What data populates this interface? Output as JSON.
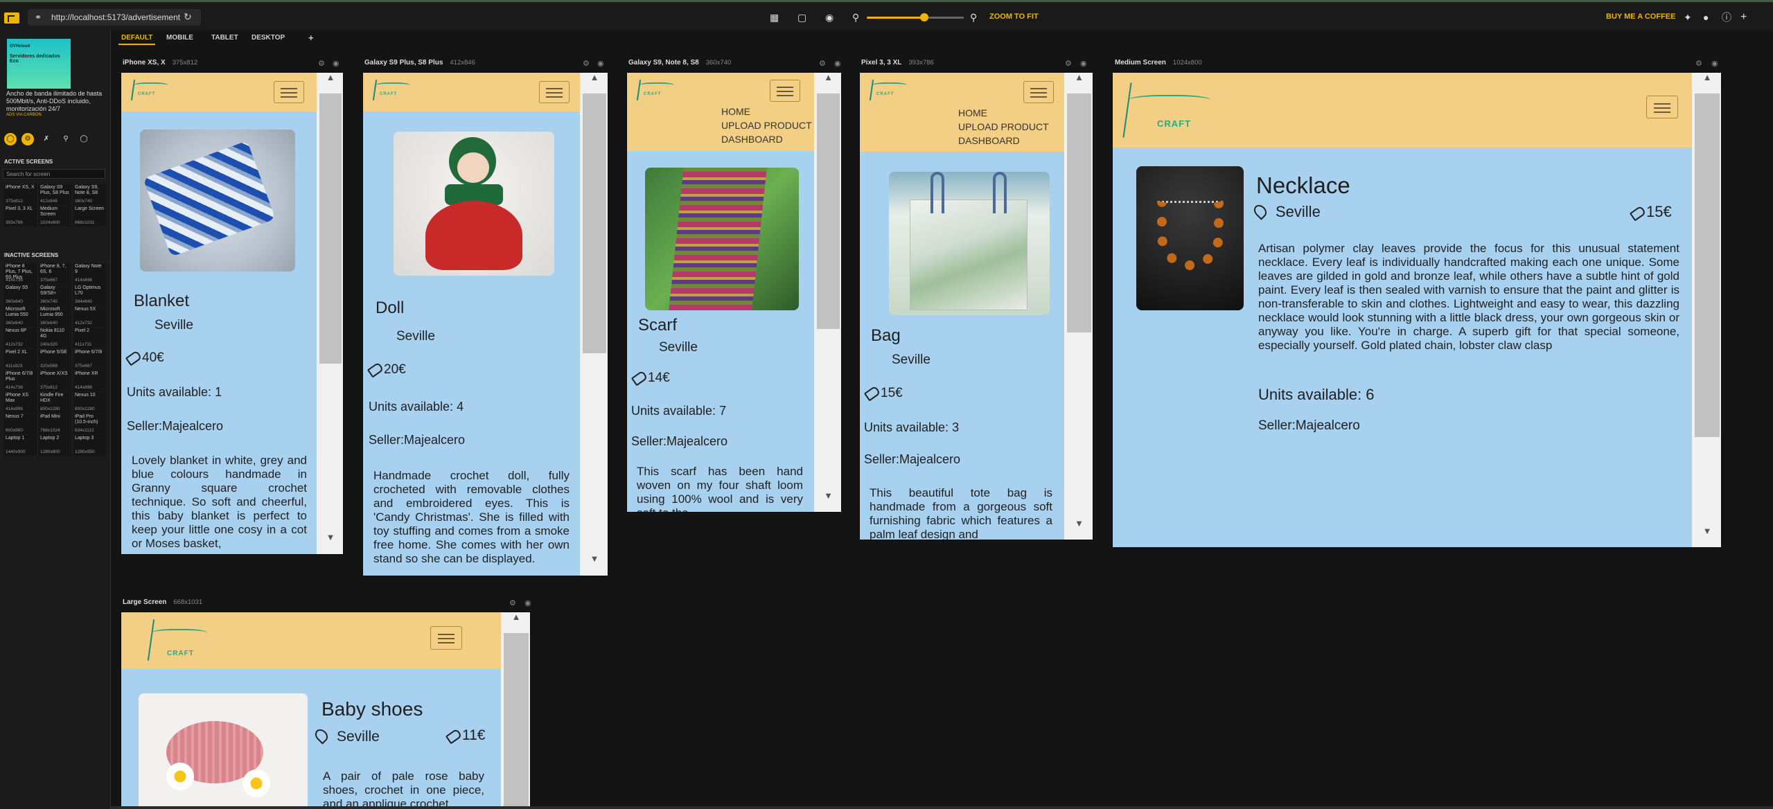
{
  "browser": {
    "url": "http://localhost:5173/advertisement",
    "zoom_to_fit": "ZOOM TO FIT",
    "buy_coffee": "BUY ME A COFFEE"
  },
  "tabs": [
    "DEFAULT",
    "MOBILE",
    "TABLET",
    "DESKTOP"
  ],
  "sidebar": {
    "ad": {
      "brand": "OVHcloud",
      "headline": "Servidores dedicados Eco",
      "text": "Ancho de banda ilimitado de hasta 500Mbit/s, Anti-DDoS incluido, monitorización 24/7",
      "link": "ADS VIA CARBON"
    },
    "active_title": "ACTIVE SCREENS",
    "search_placeholder": "Search for screen",
    "inactive_title": "INACTIVE SCREENS",
    "active": [
      [
        "iPhone XS, X",
        "375x812"
      ],
      [
        "Galaxy S9 Plus, S8 Plus",
        "412x846"
      ],
      [
        "Galaxy S9, Note 8, S8",
        "360x740"
      ],
      [
        "Pixel 3, 3 XL",
        "393x786"
      ],
      [
        "Medium Screen",
        "1024x800"
      ],
      [
        "Large Screen",
        "668x1031"
      ]
    ],
    "inactive": [
      [
        "iPhone 8 Plus, 7 Plus, 6S Plus",
        "414x736"
      ],
      [
        "iPhone 8, 7, 6S, 6",
        "375x667"
      ],
      [
        "Galaxy Note 9",
        "414x846"
      ],
      [
        "Galaxy S5",
        "360x640"
      ],
      [
        "Galaxy S9/S8+",
        "360x740"
      ],
      [
        "LG Optimus L70",
        "384x640"
      ],
      [
        "Microsoft Lumia 550",
        "360x640"
      ],
      [
        "Microsoft Lumia 950",
        "360x640"
      ],
      [
        "Nexus 5X",
        "412x732"
      ],
      [
        "Nexus 6P",
        "412x732"
      ],
      [
        "Nokia 8110 4G",
        "240x320"
      ],
      [
        "Pixel 2",
        "411x731"
      ],
      [
        "Pixel 2 XL",
        "411x823"
      ],
      [
        "iPhone 5/SE",
        "320x568"
      ],
      [
        "iPhone 6/7/8",
        "375x667"
      ],
      [
        "iPhone 6/7/8 Plus",
        "414x736"
      ],
      [
        "iPhone X/XS",
        "375x812"
      ],
      [
        "iPhone XR",
        "414x896"
      ],
      [
        "iPhone XS Max",
        "414x896"
      ],
      [
        "Kindle Fire HDX",
        "800x1280"
      ],
      [
        "Nexus 10",
        "800x1280"
      ],
      [
        "Nexus 7",
        "600x960"
      ],
      [
        "iPad Mini",
        "768x1024"
      ],
      [
        "iPad Pro (10.5-inch)",
        "834x1112"
      ],
      [
        "Laptop 1",
        "1440x900"
      ],
      [
        "Laptop 2",
        "1280x800"
      ],
      [
        "Laptop 3",
        "1280x950"
      ]
    ]
  },
  "app": {
    "brand": "CRAFT",
    "nav": [
      "HOME",
      "UPLOAD PRODUCT",
      "DASHBOARD"
    ],
    "units_prefix": "Units available: ",
    "seller": "Seller:Majealcero"
  },
  "frames": [
    {
      "name": "iPhone XS, X",
      "dim": "375x812",
      "product": "Blanket",
      "city": "Seville",
      "price": "40€",
      "units": "Units available: 1",
      "desc": "Lovely blanket in white, grey and blue colours handmade in Granny square crochet technique. So soft and cheerful, this baby blanket is perfect to keep your little one cosy in a cot or Moses basket,"
    },
    {
      "name": "Galaxy S9 Plus, S8 Plus",
      "dim": "412x846",
      "product": "Doll",
      "city": "Seville",
      "price": "20€",
      "units": "Units available: 4",
      "desc": "Handmade crochet doll, fully crocheted with removable clothes and embroidered eyes. This is 'Candy Christmas'. She is filled with toy stuffing and comes from a smoke free home. She comes with her own stand so she can be displayed."
    },
    {
      "name": "Galaxy S9, Note 8, S8",
      "dim": "360x740",
      "product": "Scarf",
      "city": "Seville",
      "price": "14€",
      "units": "Units available: 7",
      "desc": "This scarf has been hand woven on my four shaft loom using 100% wool and is very soft to the"
    },
    {
      "name": "Pixel 3, 3 XL",
      "dim": "393x786",
      "product": "Bag",
      "city": "Seville",
      "price": "15€",
      "units": "Units available: 3",
      "desc": "This beautiful tote bag is handmade from a gorgeous soft furnishing fabric which features a palm leaf design and"
    },
    {
      "name": "Medium Screen",
      "dim": "1024x800",
      "product": "Necklace",
      "city": "Seville",
      "price": "15€",
      "units": "Units available: 6",
      "desc": "Artisan polymer clay leaves provide the focus for this unusual statement necklace. Every leaf is individually handcrafted making each one unique. Some leaves are gilded in gold and bronze leaf, while others have a subtle hint of gold paint. Every leaf is then sealed with varnish to ensure that the paint and glitter is non-transferable to skin and clothes. Lightweight and easy to wear, this dazzling necklace would look stunning with a little black dress, your own gorgeous skin or anyway you like. You're in charge. A superb gift for that special someone, especially yourself. Gold plated chain, lobster claw clasp"
    },
    {
      "name": "Large Screen",
      "dim": "668x1031",
      "product": "Baby shoes",
      "city": "Seville",
      "price": "11€",
      "units": "",
      "desc": "A pair of pale rose baby shoes, crochet in one piece, and an applique crochet"
    }
  ],
  "colors": {
    "accent": "#f0b400",
    "header": "#f2cf84",
    "page": "#a8d1f0"
  }
}
